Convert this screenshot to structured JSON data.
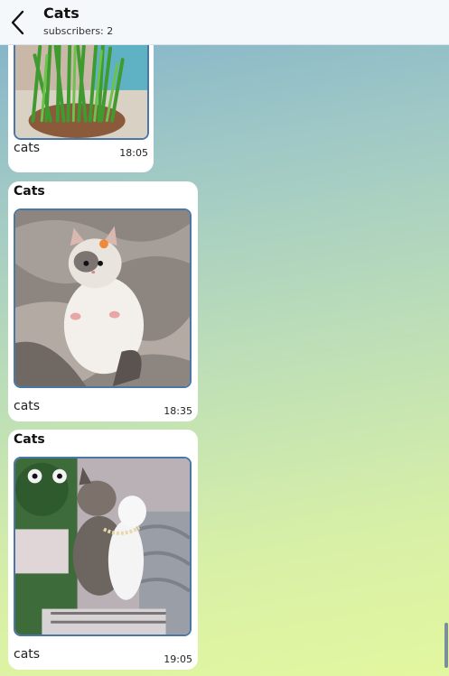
{
  "header": {
    "title": "Cats",
    "subtitle": "subscribers: 2"
  },
  "messages": [
    {
      "sender": "",
      "caption": "cats",
      "time": "18:05",
      "photo": "cat-grass-photo"
    },
    {
      "sender": "Cats",
      "caption": "cats",
      "time": "18:35",
      "photo": "fluffy-kitten-photo"
    },
    {
      "sender": "Cats",
      "caption": "cats",
      "time": "19:05",
      "photo": "two-kittens-photo"
    }
  ],
  "colors": {
    "header_bg": "#f4f8fb",
    "photo_border": "#4a77a6",
    "bubble_bg": "#ffffff"
  }
}
